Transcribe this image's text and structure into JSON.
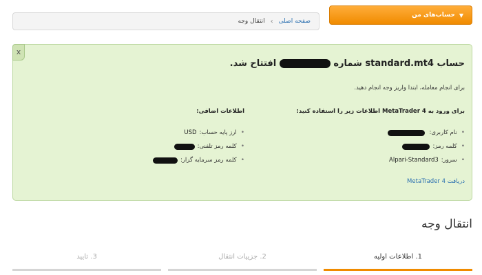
{
  "menu_button": {
    "label": "حساب‌های من"
  },
  "breadcrumb": {
    "home": "صفحه اصلی",
    "current": "انتقال وجه"
  },
  "notice": {
    "close_label": "x",
    "title_prefix": "حساب standard.mt4 شماره",
    "title_suffix": "افتتاح شد.",
    "subtitle": "برای انجام معامله، ابتدا واریز وجه انجام دهید.",
    "login_heading": "برای ورود به MetaTrader 4 اطلاعات زیر را استفاده کنید:",
    "login_items": [
      {
        "label": "نام کاربری:",
        "value": ""
      },
      {
        "label": "کلمه رمز:",
        "value": ""
      },
      {
        "label": "سرور:",
        "value": "Alpari-Standard3"
      }
    ],
    "extra_heading": "اطلاعات اضافی:",
    "extra_items": [
      {
        "label": "ارز پایه حساب:",
        "value": "USD"
      },
      {
        "label": "کلمه رمز تلفنی:",
        "value": ""
      },
      {
        "label": "کلمه رمز سرمایه گزار:",
        "value": ""
      }
    ],
    "download_link": "دریافت MetaTrader 4"
  },
  "page_title": "انتقال وجه",
  "steps": [
    {
      "label": "1. اطلاعات اولیه",
      "state": "active"
    },
    {
      "label": "2. جزییات انتقال",
      "state": "inactive"
    },
    {
      "label": "3. تایید",
      "state": "inactive"
    }
  ]
}
